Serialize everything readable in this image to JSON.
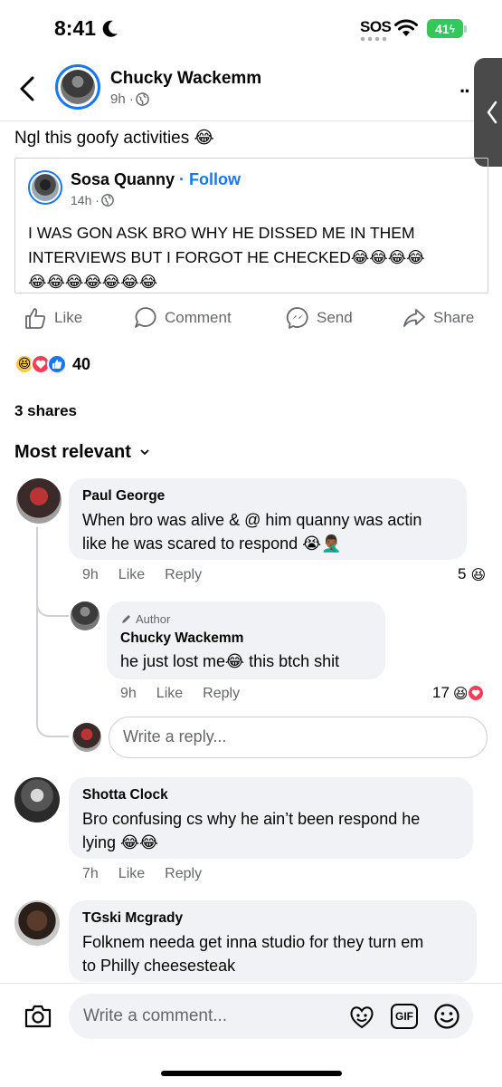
{
  "status_bar": {
    "time": "8:41",
    "sos": "SOS",
    "battery": "41"
  },
  "header": {
    "name": "Chucky Wackemm",
    "time": "9h · "
  },
  "post": {
    "caption": "Ngl this goofy activities 😂"
  },
  "shared": {
    "name": "Sosa Quanny",
    "follow": "· Follow",
    "time": "14h · ",
    "text_line1": "I WAS GON ASK BRO WHY HE DISSED ME IN THEM",
    "text_line2": "INTERVIEWS BUT I FORGOT HE CHECKED😂😂😂😂",
    "text_line3": "😂😂😂😂😂😂😂"
  },
  "actions": {
    "like": "Like",
    "comment": "Comment",
    "send": "Send",
    "share": "Share"
  },
  "reactions": {
    "emojis": [
      "😆",
      "❤",
      "👍"
    ],
    "count": "40"
  },
  "shares": "3 shares",
  "sort": "Most relevant",
  "comments": [
    {
      "name": "Paul George",
      "line1": "When bro was alive & @ him quanny was actin",
      "line2": "like he was scared to respond 😭🤦🏾‍♂️",
      "time": "9h",
      "like": "Like",
      "reply": "Reply",
      "count": "5",
      "reaction": "😆"
    },
    {
      "author_badge": "Author",
      "name": "Chucky Wackemm",
      "line1": "he just lost me😂 this btch shit",
      "time": "9h",
      "like": "Like",
      "reply": "Reply",
      "count": "17",
      "reactions": [
        "😆",
        "❤"
      ]
    },
    {
      "name": "Shotta Clock",
      "line1": "Bro confusing cs why he ain’t been respond he",
      "line2": "lying 😂😂",
      "time": "7h",
      "like": "Like",
      "reply": "Reply"
    },
    {
      "name": "TGski Mcgrady",
      "line1": "Folknem needa get inna studio for they turn em",
      "line2": "to Philly cheesesteak"
    }
  ],
  "reply_placeholder": "Write a reply...",
  "composer": {
    "placeholder": "Write a comment...",
    "gif": "GIF"
  },
  "colors": {
    "accent": "#1877f2",
    "bubble": "#f0f2f5",
    "meta": "#65676b",
    "battery": "#34c759"
  }
}
